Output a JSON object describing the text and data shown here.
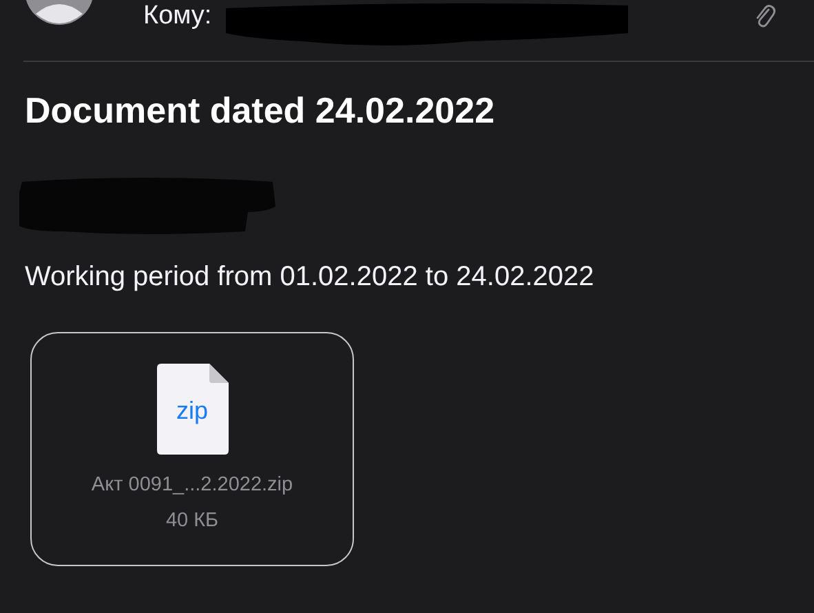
{
  "header": {
    "to_label": "Кому:"
  },
  "message": {
    "subject": "Document dated 24.02.2022",
    "body": "Working period from 01.02.2022 to 24.02.2022"
  },
  "attachments": [
    {
      "kind": "zip",
      "type_label": "zip",
      "name": "Акт 0091_...2.2022.zip",
      "size": "40 КБ"
    }
  ]
}
